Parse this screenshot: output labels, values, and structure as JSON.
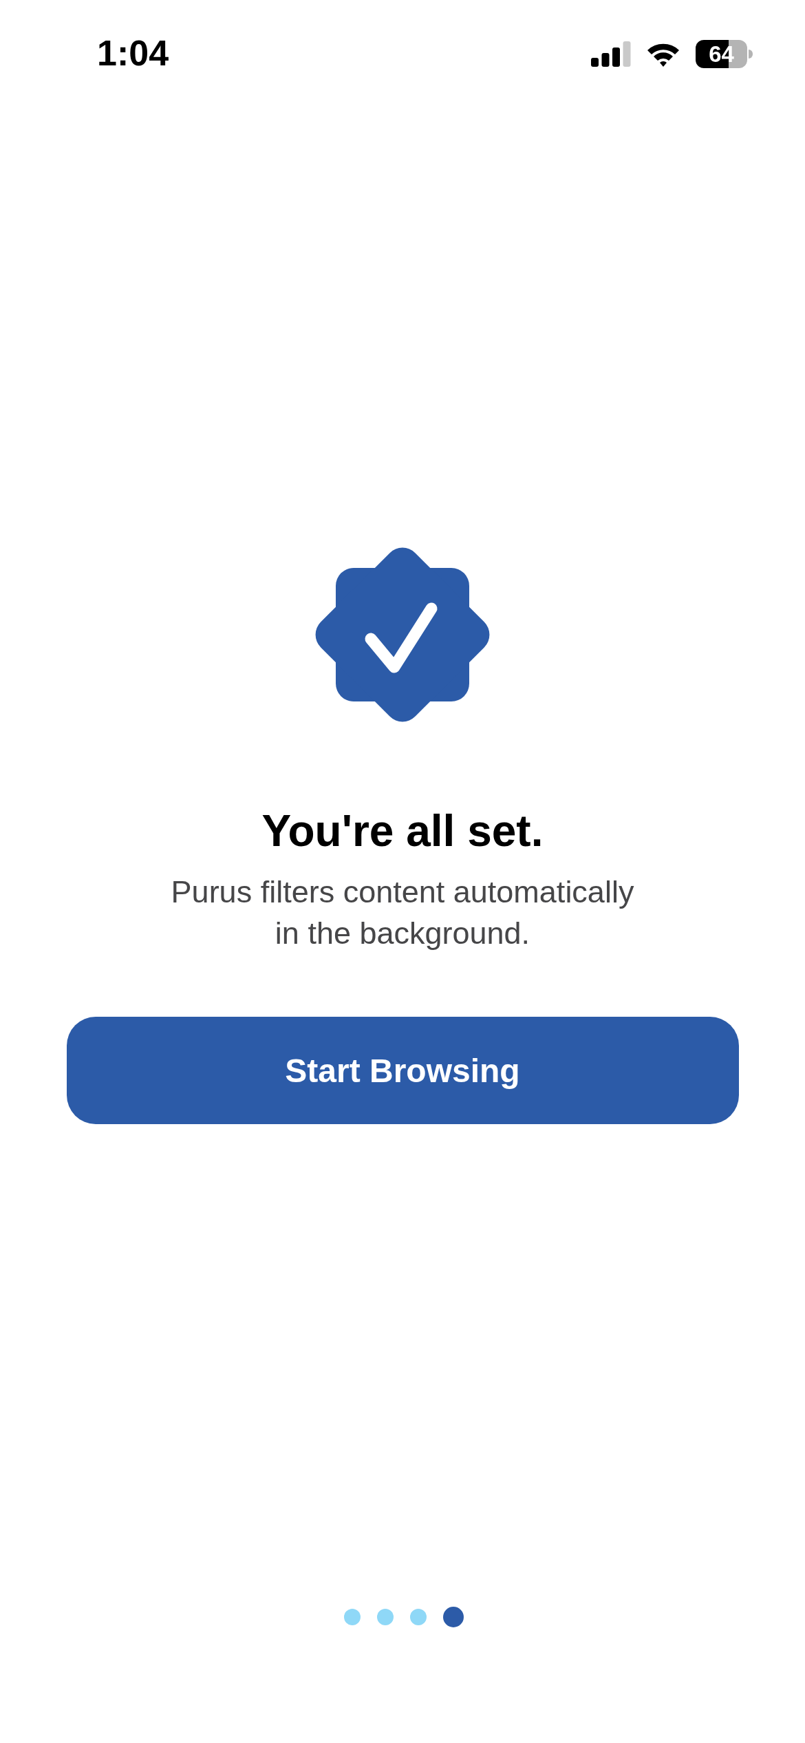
{
  "status_bar": {
    "time": "1:04",
    "battery": "64"
  },
  "title": "You're all set.",
  "subtitle": "Purus filters content automatically in the background.",
  "primary_button": {
    "label": "Start Browsing"
  },
  "page_indicator": [
    {
      "selected": false
    },
    {
      "selected": false
    },
    {
      "selected": false
    },
    {
      "selected": true
    }
  ]
}
